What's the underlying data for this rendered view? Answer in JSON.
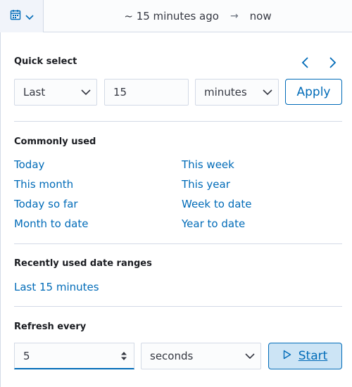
{
  "topbar": {
    "calendar_icon": "calendar-icon",
    "chevron_icon": "chevron-down-icon",
    "start_label": "~ 15 minutes ago",
    "end_label": "now"
  },
  "quick_select": {
    "title": "Quick select",
    "tense": "Last",
    "value": "15",
    "unit": "minutes",
    "apply_label": "Apply"
  },
  "commonly_used": {
    "title": "Commonly used",
    "items": [
      "Today",
      "This week",
      "This month",
      "This year",
      "Today so far",
      "Week to date",
      "Month to date",
      "Year to date"
    ]
  },
  "recent": {
    "title": "Recently used date ranges",
    "items": [
      "Last 15 minutes"
    ]
  },
  "refresh": {
    "title": "Refresh every",
    "value": "5",
    "unit": "seconds",
    "start_label": "Start"
  },
  "colors": {
    "accent": "#006bb8",
    "start_bg": "#cce4f5",
    "border": "#d3dae6"
  }
}
